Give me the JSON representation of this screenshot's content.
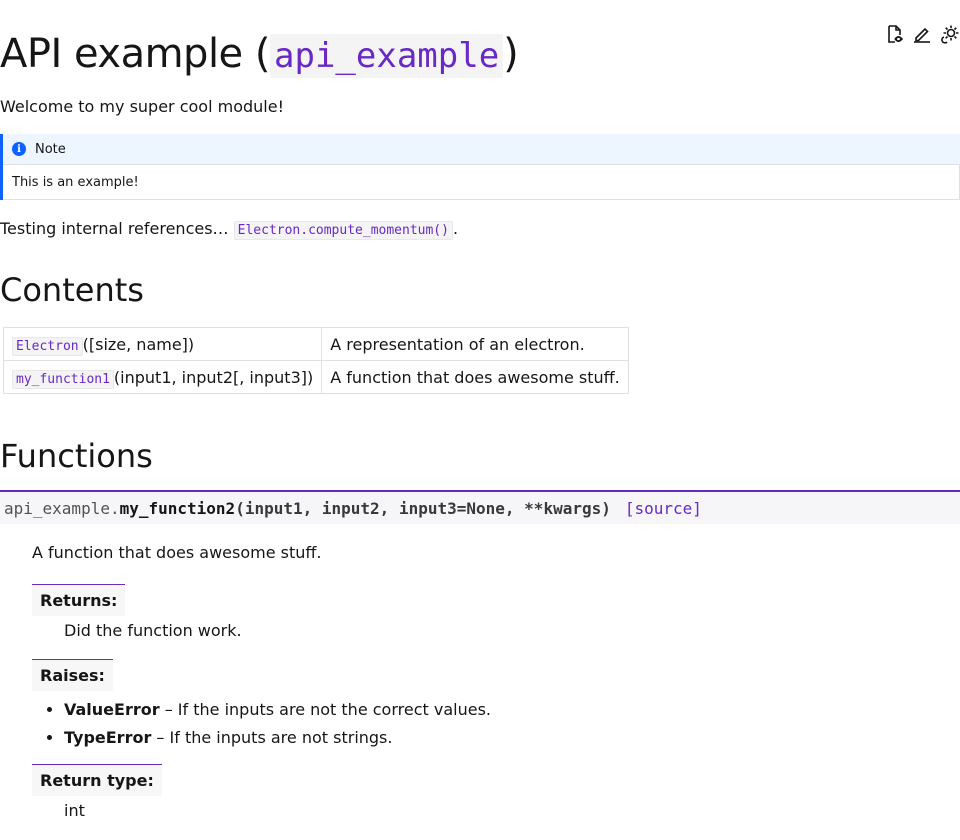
{
  "toolbar": {
    "icons": [
      "view-source-icon",
      "edit-icon",
      "theme-toggle-icon"
    ]
  },
  "page": {
    "title_text": "API example",
    "title_open": "(",
    "title_code": "api_example",
    "title_close": ")",
    "intro": "Welcome to my super cool module!"
  },
  "note": {
    "title": "Note",
    "body": "This is an example!"
  },
  "refs": {
    "prefix": "Testing internal references…",
    "link": "Electron.compute_momentum()",
    "suffix": "."
  },
  "contents": {
    "heading": "Contents",
    "rows": [
      {
        "name": "Electron",
        "args": "([size, name])",
        "desc": "A representation of an electron."
      },
      {
        "name": "my_function1",
        "args": "(input1, input2[, input3])",
        "desc": "A function that does awesome stuff."
      }
    ]
  },
  "functions": {
    "heading": "Functions",
    "signature": {
      "prefix": "api_example.",
      "name": "my_function2",
      "params": "(input1, input2, input3=None, **kwargs)",
      "source": "[source]"
    },
    "description": "A function that does awesome stuff.",
    "returns_label": "Returns:",
    "returns_text": "Did the function work.",
    "raises_label": "Raises:",
    "raises": [
      {
        "name": "ValueError",
        "text": " – If the inputs are not the correct values."
      },
      {
        "name": "TypeError",
        "text": " – If the inputs are not strings."
      }
    ],
    "rtype_label": "Return type:",
    "rtype": "int"
  }
}
